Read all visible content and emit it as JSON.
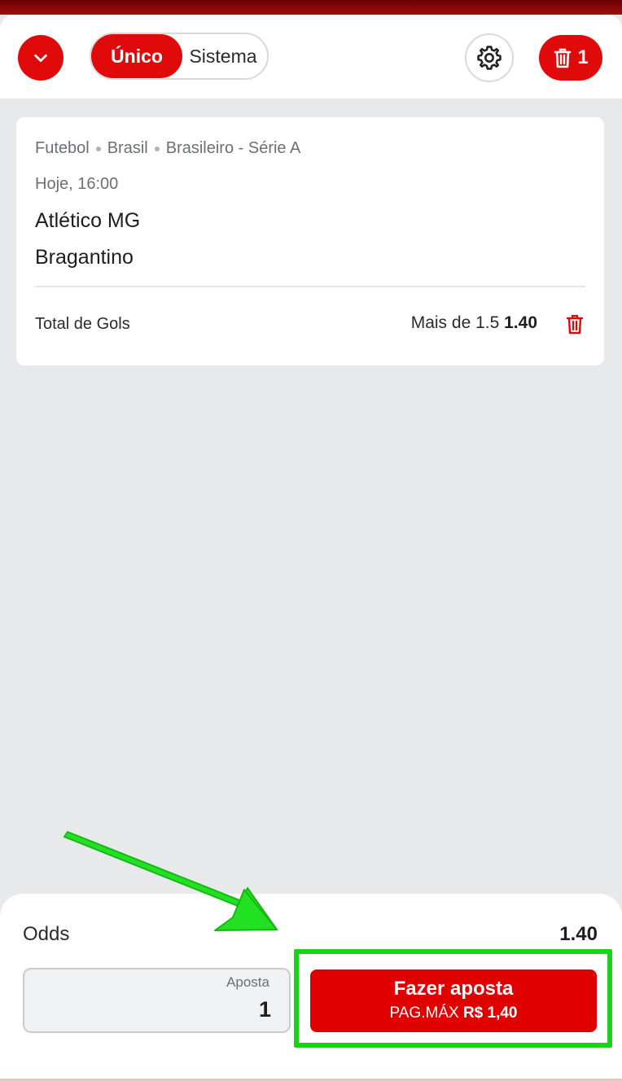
{
  "header": {
    "mode_active": "Único",
    "mode_inactive": "Sistema",
    "bet_count": "1"
  },
  "event": {
    "sport": "Futebol",
    "country": "Brasil",
    "league": "Brasileiro - Série A",
    "time": "Hoje, 16:00",
    "home_team": "Atlético MG",
    "away_team": "Bragantino",
    "market": "Total de Gols",
    "selection": "Mais de 1.5",
    "odd": "1.40"
  },
  "footer": {
    "odds_label": "Odds",
    "odds_value": "1.40",
    "stake_label": "Aposta",
    "stake_value": "1",
    "place_bet_label": "Fazer aposta",
    "max_payout_prefix": "PAG.MÁX",
    "max_payout_value": "R$ 1,40"
  },
  "colors": {
    "brand_red": "#e00a0a",
    "highlight_green": "#16d416"
  }
}
